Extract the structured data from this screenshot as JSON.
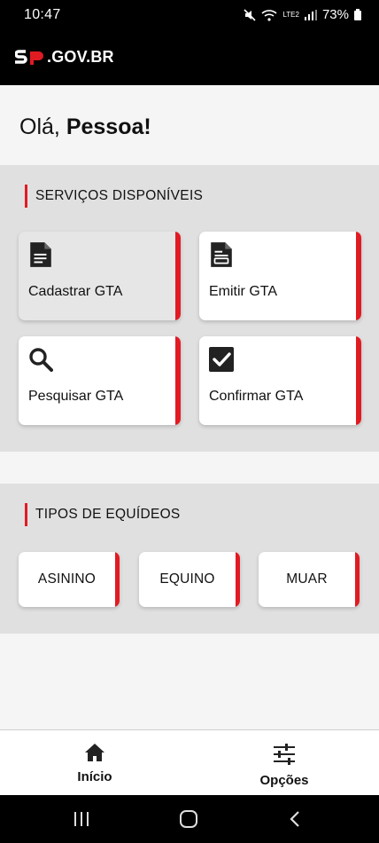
{
  "status_bar": {
    "time": "10:47",
    "battery": "73%",
    "network": "LTE2"
  },
  "header": {
    "logo_mark": "SP",
    "logo_text": ".GOV.BR"
  },
  "greeting": {
    "prefix": "Olá,",
    "name": "Pessoa!"
  },
  "services": {
    "title": "SERVIÇOS DISPONÍVEIS",
    "items": [
      {
        "label": "Cadastrar GTA",
        "icon": "document-icon"
      },
      {
        "label": "Emitir GTA",
        "icon": "document-edit-icon"
      },
      {
        "label": "Pesquisar GTA",
        "icon": "search-icon"
      },
      {
        "label": "Confirmar GTA",
        "icon": "checkbox-checked-icon"
      }
    ]
  },
  "types": {
    "title": "TIPOS DE EQUÍDEOS",
    "items": [
      {
        "label": "ASININO"
      },
      {
        "label": "EQUINO"
      },
      {
        "label": "MUAR"
      }
    ]
  },
  "bottom_nav": {
    "items": [
      {
        "label": "Início",
        "icon": "home-icon"
      },
      {
        "label": "Opções",
        "icon": "sliders-icon"
      }
    ]
  },
  "colors": {
    "accent": "#e11b22",
    "header_bg": "#000000",
    "section_bg": "#e0e0e0"
  }
}
